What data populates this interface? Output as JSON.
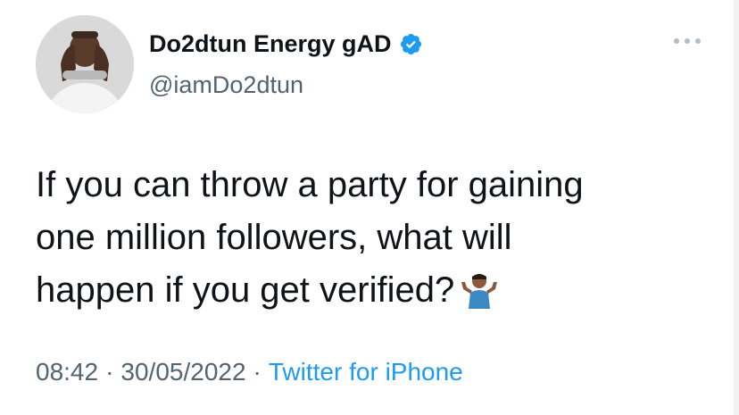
{
  "tweet": {
    "author": {
      "display_name": "Do2dtun Energy gAD",
      "handle": "@iamDo2dtun",
      "verified": true,
      "avatar_icon": "profile-photo"
    },
    "more_icon": "more-horizontal-icon",
    "text_lines": [
      "If you can throw a party for gaining",
      "one million followers, what will",
      "happen if you get verified?"
    ],
    "emoji": "🤷🏾‍♂️",
    "time": "08:42",
    "separator": "·",
    "date": "30/05/2022",
    "source": "Twitter for iPhone"
  },
  "colors": {
    "text": "#0f1419",
    "secondary": "#536471",
    "link": "#1d9bf0",
    "verified_badge": "#1d9bf0"
  }
}
